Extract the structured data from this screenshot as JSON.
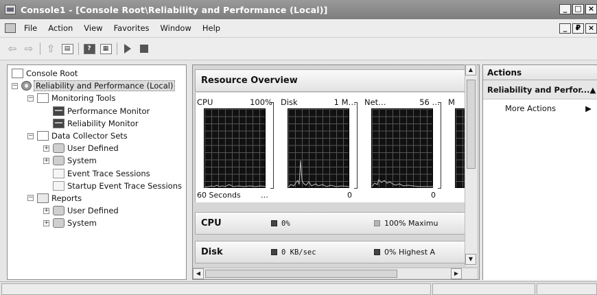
{
  "window": {
    "title": "Console1 - [Console Root\\Reliability and Performance (Local)]",
    "controls": [
      "_",
      "□",
      "×"
    ]
  },
  "menubar": {
    "items": [
      "File",
      "Action",
      "View",
      "Favorites",
      "Window",
      "Help"
    ],
    "controls": [
      "_",
      "₽",
      "×"
    ]
  },
  "tree": {
    "nodes": [
      {
        "label": "Console Root",
        "icon": "folder-icon",
        "depth": 0,
        "expander": ""
      },
      {
        "label": "Reliability and Performance (Local)",
        "icon": "gear-icon",
        "depth": 0,
        "expander": "−",
        "selected": true
      },
      {
        "label": "Monitoring Tools",
        "icon": "folder-icon",
        "depth": 1,
        "expander": "−"
      },
      {
        "label": "Performance Monitor",
        "icon": "monitor-icon",
        "depth": 2,
        "expander": ""
      },
      {
        "label": "Reliability Monitor",
        "icon": "monitor-icon",
        "depth": 2,
        "expander": ""
      },
      {
        "label": "Data Collector Sets",
        "icon": "folder-icon",
        "depth": 1,
        "expander": "−"
      },
      {
        "label": "User Defined",
        "icon": "user-icon",
        "depth": 2,
        "expander": "+"
      },
      {
        "label": "System",
        "icon": "system-icon",
        "depth": 2,
        "expander": "+"
      },
      {
        "label": "Event Trace Sessions",
        "icon": "document-icon",
        "depth": 2,
        "expander": ""
      },
      {
        "label": "Startup Event Trace Sessions",
        "icon": "document-icon",
        "depth": 2,
        "expander": ""
      },
      {
        "label": "Reports",
        "icon": "report-icon",
        "depth": 1,
        "expander": "−"
      },
      {
        "label": "User Defined",
        "icon": "user-icon",
        "depth": 2,
        "expander": "+"
      },
      {
        "label": "System",
        "icon": "system-icon",
        "depth": 2,
        "expander": "+"
      }
    ]
  },
  "resource_overview": {
    "title": "Resource Overview",
    "graphs": [
      {
        "name": "CPU",
        "max": "100%",
        "foot_left": "60 Seconds",
        "foot_right": "…"
      },
      {
        "name": "Disk",
        "max": "1 M…",
        "foot_left": "",
        "foot_right": "0"
      },
      {
        "name": "Net…",
        "max": "56 …",
        "foot_left": "",
        "foot_right": "0"
      },
      {
        "name": "M",
        "max": "",
        "foot_left": "",
        "foot_right": ""
      }
    ],
    "rows": [
      {
        "name": "CPU",
        "value": "0%",
        "value2": "100% Maximu"
      },
      {
        "name": "Disk",
        "value": "0 KB/sec",
        "value2": "0% Highest A"
      }
    ]
  },
  "actions": {
    "header": "Actions",
    "section": "Reliability and Perfor...",
    "section_arrow": "▲",
    "more": "More Actions",
    "more_arrow": "▶"
  }
}
